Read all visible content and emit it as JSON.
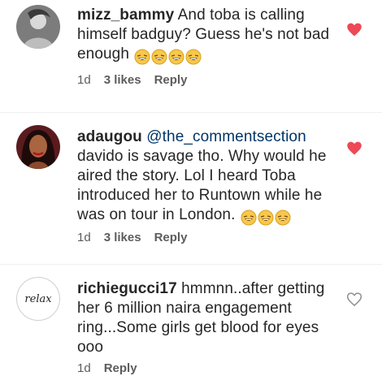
{
  "comments": [
    {
      "username": "mizz_bammy",
      "text": "And toba is calling himself badguy? Guess he's not bad enough",
      "emoji_count": 4,
      "time": "1d",
      "likes": "3 likes",
      "reply": "Reply",
      "liked": true,
      "avatar_icon": "user-photo-icon"
    },
    {
      "username": "adaugou",
      "mention": "@the_commentsection",
      "text": "davido is savage tho. Why would he aired the story. Lol I heard Toba introduced her to Runtown while he was on tour in London.",
      "emoji_count": 3,
      "time": "1d",
      "likes": "3 likes",
      "reply": "Reply",
      "liked": true,
      "avatar_icon": "user-photo-icon"
    },
    {
      "username": "richiegucci17",
      "text": "hmmnn..after getting her 6 million naira engagement ring...Some girls get blood for eyes ooo",
      "time": "1d",
      "reply": "Reply",
      "liked": false,
      "avatar_text": "relax",
      "avatar_icon": "relax-logo-icon"
    }
  ],
  "colors": {
    "heart_active": "#ed4956",
    "heart_inactive": "#8e8e8e",
    "text": "#262626",
    "meta": "#8e8e8e",
    "mention": "#003569"
  },
  "icons": {
    "emoji": "laughing-emoji-icon",
    "like": "heart-icon"
  }
}
